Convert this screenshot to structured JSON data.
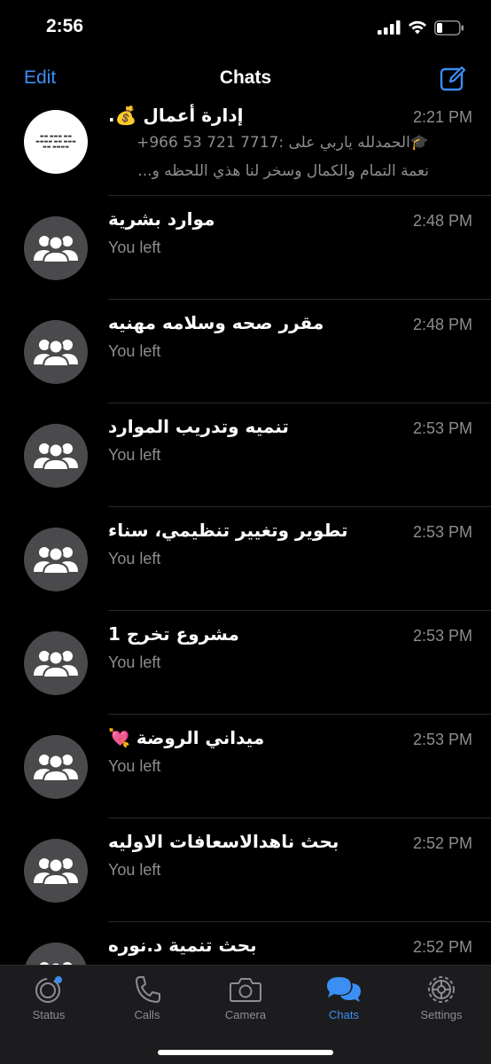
{
  "status": {
    "time": "2:56"
  },
  "nav": {
    "edit_label": "Edit",
    "title": "Chats"
  },
  "chats": [
    {
      "name": "إدارة أعمال 💰.",
      "time": "2:21 PM",
      "preview_line1": "🎓الحمدلله ياربي على :7717 721 53 966+",
      "preview_line2": "نعمة التمام والكمال وسخر لنا هذي اللحظه و...",
      "avatar": "image"
    },
    {
      "name": "موارد بشرية",
      "time": "2:48 PM",
      "preview": "You left",
      "avatar": "group"
    },
    {
      "name": "مقرر صحه وسلامه مهنيه",
      "time": "2:48 PM",
      "preview": "You left",
      "avatar": "group"
    },
    {
      "name": "تنميه وتدريب الموارد",
      "time": "2:53 PM",
      "preview": "You left",
      "avatar": "group"
    },
    {
      "name": "تطوير وتغيير تنظيمي، سناء",
      "time": "2:53 PM",
      "preview": "You left",
      "avatar": "group"
    },
    {
      "name": "مشروع تخرج 1",
      "time": "2:53 PM",
      "preview": "You left",
      "avatar": "group"
    },
    {
      "name": "ميداني الروضة 💘",
      "time": "2:53 PM",
      "preview": "You left",
      "avatar": "group"
    },
    {
      "name": "بحث ناهدالاسعافات الاوليه",
      "time": "2:52 PM",
      "preview": "You left",
      "avatar": "group"
    },
    {
      "name": "بحث تنمية د.نوره",
      "time": "2:52 PM",
      "preview": "",
      "avatar": "group"
    }
  ],
  "tabs": [
    {
      "label": "Status",
      "icon": "status-icon",
      "active": false
    },
    {
      "label": "Calls",
      "icon": "phone-icon",
      "active": false
    },
    {
      "label": "Camera",
      "icon": "camera-icon",
      "active": false
    },
    {
      "label": "Chats",
      "icon": "chat-bubbles-icon",
      "active": true
    },
    {
      "label": "Settings",
      "icon": "gear-icon",
      "active": false
    }
  ],
  "colors": {
    "accent": "#3b8ef3",
    "secondary_text": "#8d8d92",
    "tab_bar": "#1c1c1e",
    "avatar_bg": "#4a4a4d"
  }
}
